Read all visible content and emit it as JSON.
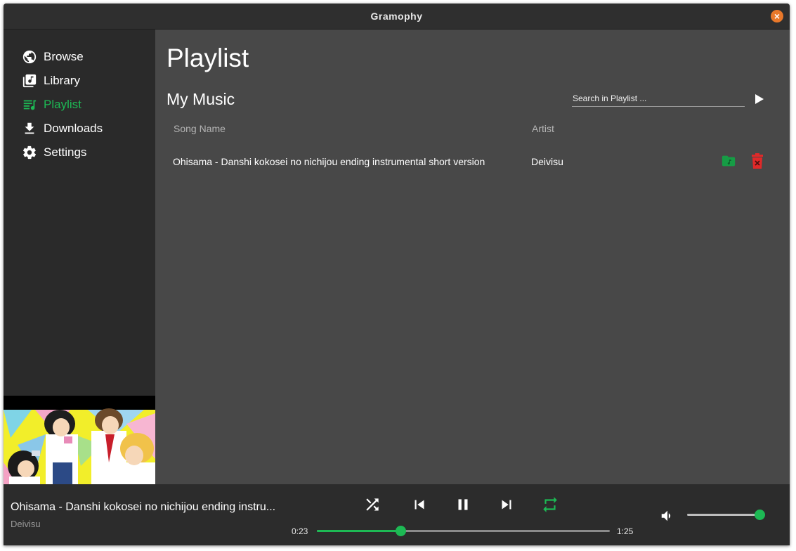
{
  "window": {
    "title": "Gramophy"
  },
  "sidebar": {
    "items": [
      {
        "label": "Browse",
        "icon": "globe-icon",
        "active": false
      },
      {
        "label": "Library",
        "icon": "library-music-icon",
        "active": false
      },
      {
        "label": "Playlist",
        "icon": "playlist-icon",
        "active": true
      },
      {
        "label": "Downloads",
        "icon": "download-icon",
        "active": false
      },
      {
        "label": "Settings",
        "icon": "gear-icon",
        "active": false
      }
    ],
    "cover_art": "anime-group-cover-art"
  },
  "main": {
    "page_title": "Playlist",
    "section_title": "My Music",
    "search_placeholder": "Search in Playlist ...",
    "columns": {
      "song": "Song Name",
      "artist": "Artist"
    },
    "rows": [
      {
        "song": "Ohisama - Danshi kokosei no nichijou ending instrumental short version",
        "artist": "Deivisu"
      }
    ]
  },
  "player": {
    "title": "Ohisama - Danshi kokosei no nichijou ending instru...",
    "artist": "Deivisu",
    "elapsed": "0:23",
    "duration": "1:25",
    "progress_fraction": 0.285,
    "volume_fraction": 1.0,
    "shuffle": false,
    "repeat": true
  },
  "colors": {
    "accent": "#1db954",
    "delete": "#e02929",
    "close": "#e9782a",
    "sidebar_bg": "#2a2a2a",
    "main_bg": "#484848",
    "player_bg": "#2c2c2c"
  }
}
